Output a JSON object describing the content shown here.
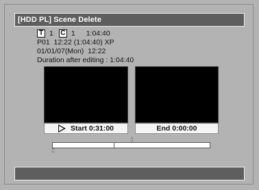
{
  "header": {
    "title": "[HDD PL] Scene Delete"
  },
  "info": {
    "title_icon": "T",
    "title_number": "1",
    "chapter_icon": "C",
    "chapter_number": "1",
    "total_time": "1:04:40",
    "line2": "P01  12:22 (1:04:40) XP",
    "line3": "01/01/07(Mon)  12:22",
    "line4": "Duration after editing : 1:04:40"
  },
  "thumbnails": {
    "start_label": "Start  0:31:00",
    "end_label": "End  0:00:00"
  },
  "timeline": {
    "split_fraction": 0.39
  },
  "colors": {
    "background": "#b3b3b3",
    "bar": "#5e5e5e",
    "label_bg": "#f4f4f4"
  }
}
